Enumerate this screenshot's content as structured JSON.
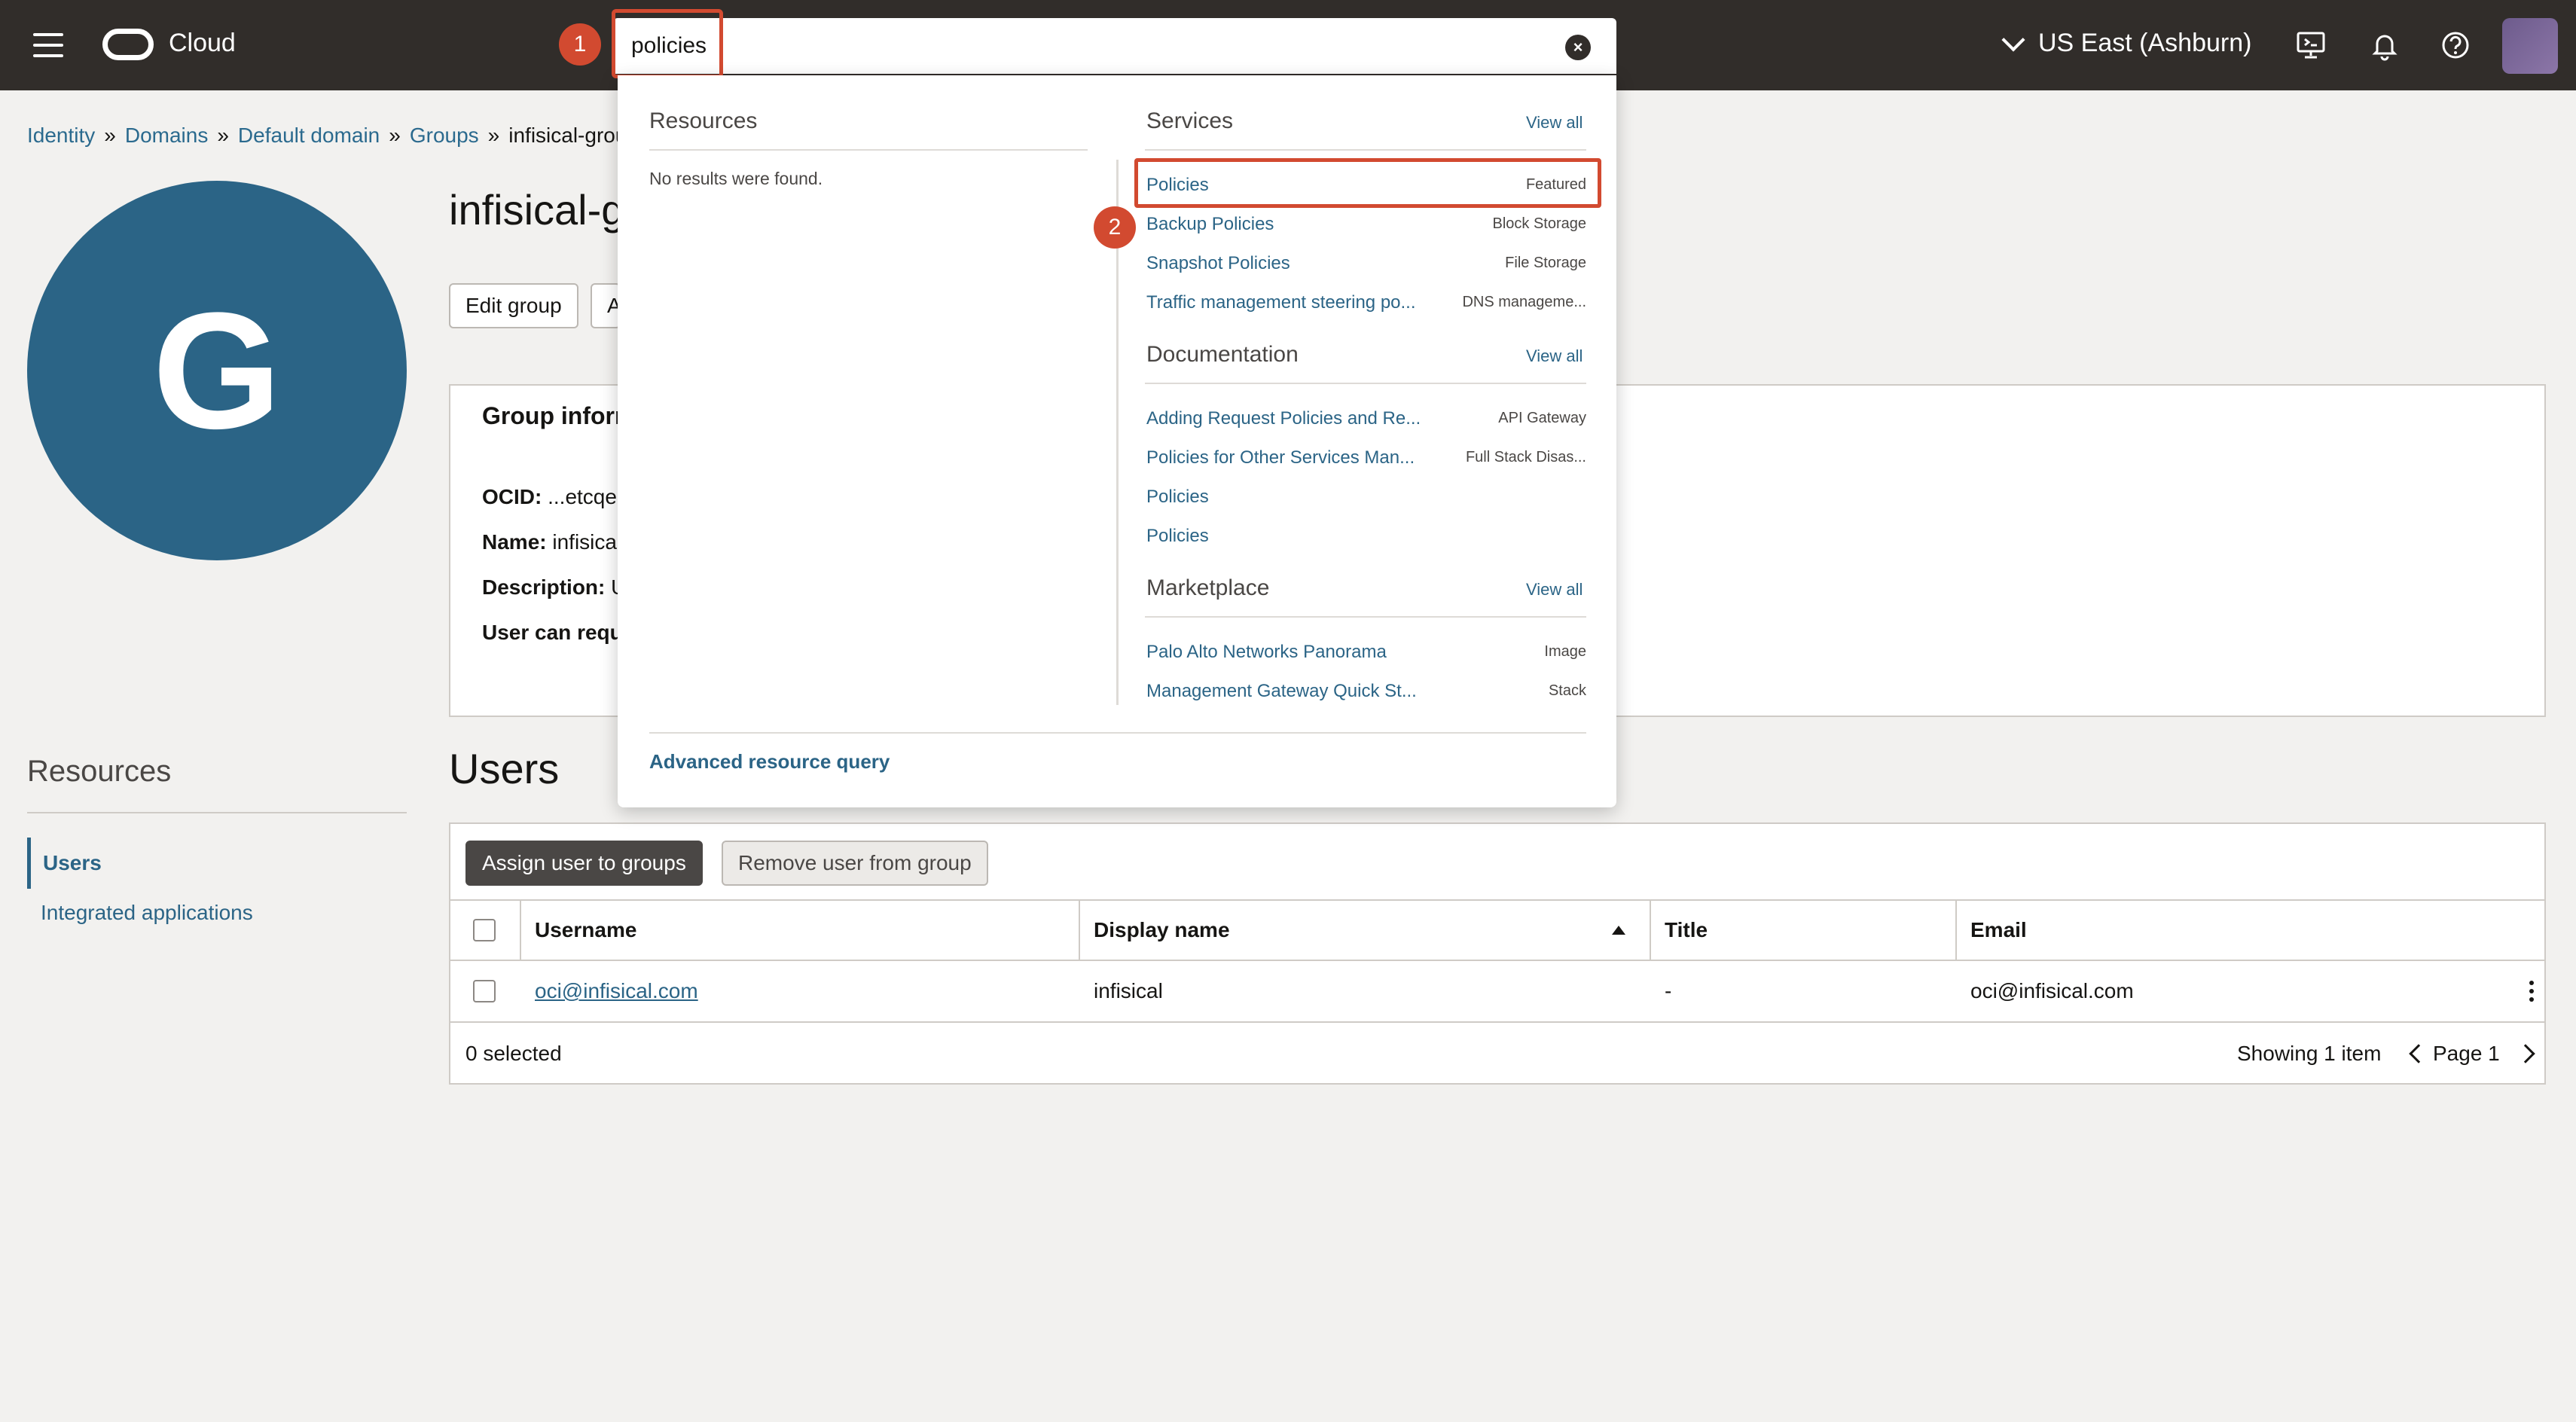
{
  "topbar": {
    "brand": "Cloud",
    "search_value": "policies",
    "region": "US East (Ashburn)",
    "icons": [
      "menu-icon",
      "oracle-logo",
      "clear-icon",
      "chevron-down-icon",
      "cloud-shell-icon",
      "bell-icon",
      "help-icon",
      "profile-avatar"
    ]
  },
  "annotations": {
    "step1": "1",
    "step2": "2",
    "highlight_color": "#d24a30"
  },
  "breadcrumb": {
    "items": [
      "Identity",
      "Domains",
      "Default domain",
      "Groups"
    ],
    "separator": "»",
    "current": "infisical-group"
  },
  "group": {
    "avatar_letter": "G",
    "title": "infisical-g",
    "buttons": [
      "Edit group",
      "A"
    ],
    "info_title": "Group inforn",
    "info": [
      {
        "label": "OCID:",
        "value": " ...etcqe"
      },
      {
        "label": "Name:",
        "value": " infisica"
      },
      {
        "label": "Description:",
        "value": " U"
      },
      {
        "label": "User can requ",
        "value": ""
      }
    ]
  },
  "resources": {
    "title": "Resources",
    "items": [
      "Users",
      "Integrated applications"
    ]
  },
  "users": {
    "title": "Users",
    "assign_button": "Assign user to groups",
    "remove_button": "Remove user from group",
    "columns": [
      "Username",
      "Display name",
      "Title",
      "Email"
    ],
    "rows": [
      {
        "username": "oci@infisical.com",
        "display_name": "infisical",
        "title": "-",
        "email": "oci@infisical.com"
      }
    ],
    "selected": "0 selected",
    "showing": "Showing 1 item",
    "page": "Page 1"
  },
  "search_dropdown": {
    "resources_title": "Resources",
    "no_results": "No results were found.",
    "services_title": "Services",
    "services_view_all": "View all",
    "services": [
      {
        "name": "Policies",
        "category": "Featured"
      },
      {
        "name": "Backup Policies",
        "category": "Block Storage"
      },
      {
        "name": "Snapshot Policies",
        "category": "File Storage"
      },
      {
        "name": "Traffic management steering po...",
        "category": "DNS manageme..."
      }
    ],
    "documentation_title": "Documentation",
    "documentation_view_all": "View all",
    "documentation": [
      {
        "name": "Adding Request Policies and Re...",
        "category": "API Gateway"
      },
      {
        "name": "Policies for Other Services Man...",
        "category": "Full Stack Disas..."
      },
      {
        "name": "Policies",
        "category": ""
      },
      {
        "name": "Policies",
        "category": ""
      }
    ],
    "marketplace_title": "Marketplace",
    "marketplace_view_all": "View all",
    "marketplace": [
      {
        "name": "Palo Alto Networks Panorama",
        "category": "Image"
      },
      {
        "name": "Management Gateway Quick St...",
        "category": "Stack"
      }
    ],
    "advanced_query": "Advanced resource query"
  }
}
